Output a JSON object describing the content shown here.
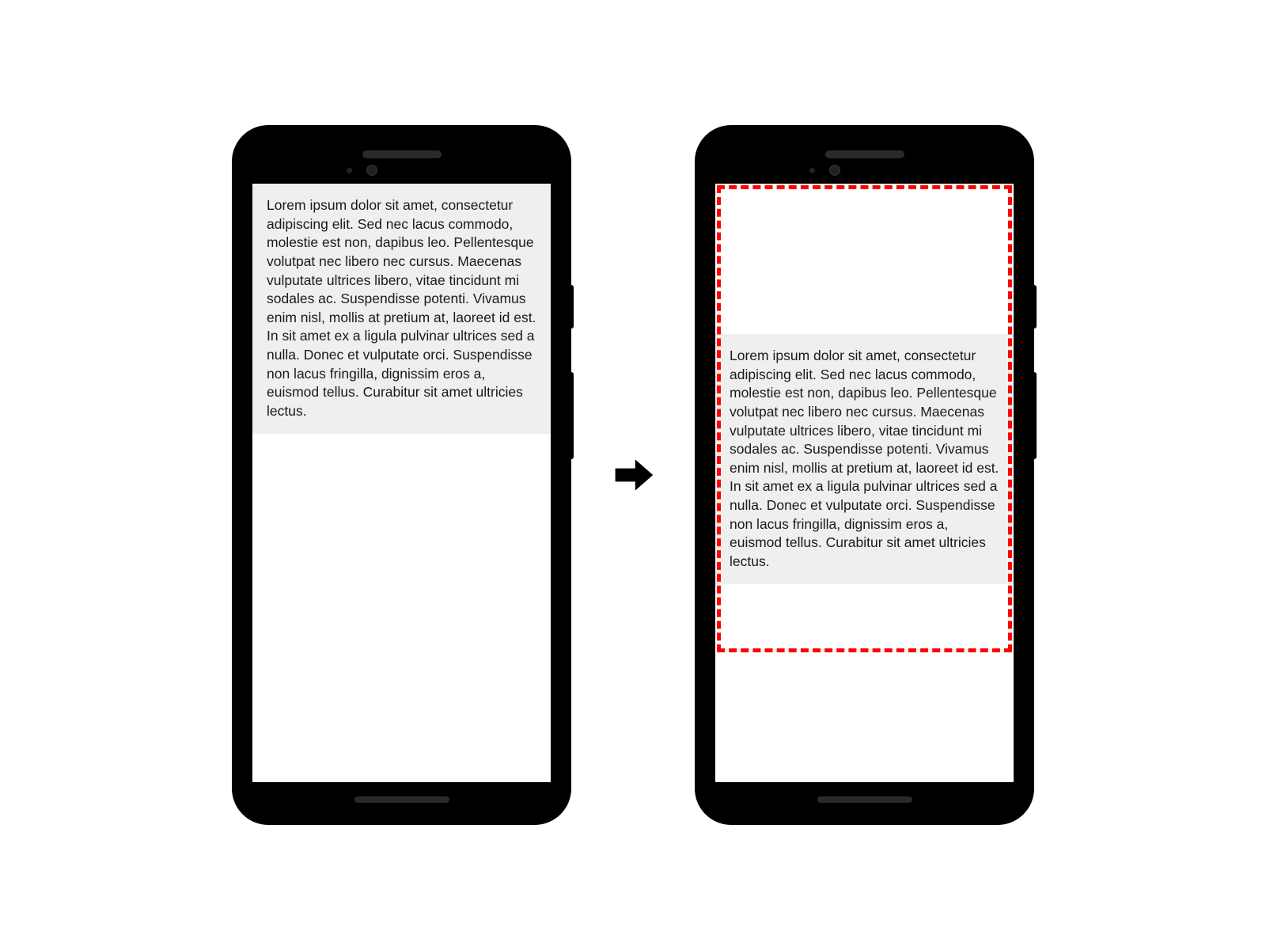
{
  "diagram": {
    "phone_left": {
      "lorem_text": "Lorem ipsum dolor sit amet, consectetur adipiscing elit. Sed nec lacus commodo, molestie est non, dapibus leo. Pellentesque volutpat nec libero nec cursus. Maecenas vulputate ultrices libero, vitae tincidunt mi sodales ac. Suspendisse potenti. Vivamus enim nisl, mollis at pretium at, laoreet id est. In sit amet ex a ligula pulvinar ultrices sed a nulla. Donec et vulputate orci. Suspendisse non lacus fringilla, dignissim eros a, euismod tellus. Curabitur sit amet ultricies lectus."
    },
    "phone_right": {
      "lorem_text": "Lorem ipsum dolor sit amet, consectetur adipiscing elit. Sed nec lacus commodo, molestie est non, dapibus leo. Pellentesque volutpat nec libero nec cursus. Maecenas vulputate ultrices libero, vitae tincidunt mi sodales ac. Suspendisse potenti. Vivamus enim nisl, mollis at pretium at, laoreet id est. In sit amet ex a ligula pulvinar ultrices sed a nulla. Donec et vulputate orci. Suspendisse non lacus fringilla, dignissim eros a, euismod tellus. Curabitur sit amet ultricies lectus."
    }
  }
}
